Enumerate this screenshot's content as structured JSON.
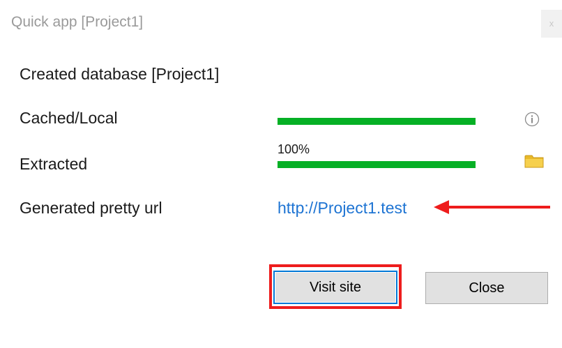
{
  "window": {
    "title": "Quick app [Project1]",
    "close_glyph": "x"
  },
  "rows": {
    "created_label": "Created database [Project1]",
    "cached_label": "Cached/Local",
    "extracted_label": "Extracted",
    "url_label": "Generated pretty url"
  },
  "progress": {
    "cached_value": 1.0,
    "extracted_value": 1.0,
    "extracted_text": "100%"
  },
  "url": {
    "text": "http://Project1.test"
  },
  "buttons": {
    "visit_label": "Visit site",
    "close_label": "Close"
  },
  "icons": {
    "info": "info-icon",
    "folder": "folder-icon"
  },
  "colors": {
    "progress_green": "#06b025",
    "link_blue": "#1e74d3",
    "annotation_red": "#ee1c1c",
    "focus_blue": "#0078d7"
  }
}
